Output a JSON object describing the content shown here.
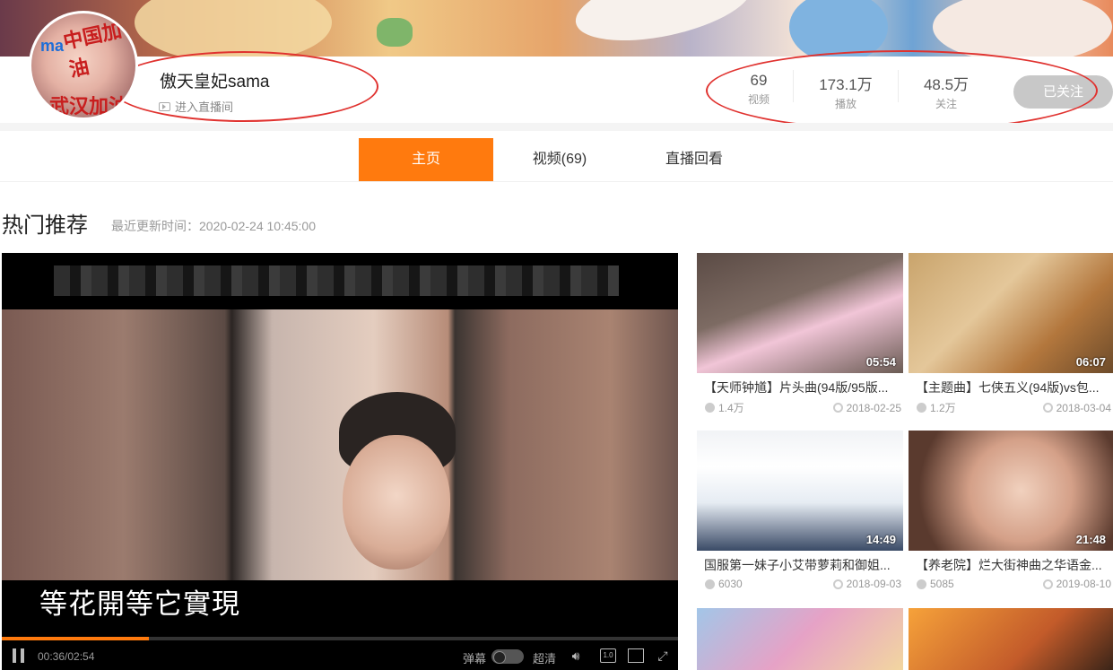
{
  "banner": {},
  "profile": {
    "avatar_text_1": "中国加油",
    "avatar_text_2": "武汉加油",
    "avatar_text_3": "ma",
    "username": "傲天皇妃sama",
    "live_link": "进入直播间"
  },
  "stats": [
    {
      "value": "69",
      "label": "视频"
    },
    {
      "value": "173.1万",
      "label": "播放"
    },
    {
      "value": "48.5万",
      "label": "关注"
    }
  ],
  "follow_button": "已关注",
  "tabs": [
    {
      "label": "主页",
      "active": true
    },
    {
      "label": "视频(69)",
      "active": false
    },
    {
      "label": "直播回看",
      "active": false
    }
  ],
  "section": {
    "title": "热门推荐",
    "update_time": "最近更新时间：2020-02-24 10:45:00"
  },
  "player": {
    "subtitle": "等花開等它實現",
    "time": "00:36/02:54",
    "progress": 0.218,
    "danmu_label": "弹幕",
    "quality": "超清",
    "speed_icon_text": "1.0"
  },
  "videos": [
    {
      "title": "【天师钟馗】片头曲(94版/95版...",
      "plays": "1.4万",
      "date": "2018-02-25",
      "duration": "05:54"
    },
    {
      "title": "【主题曲】七侠五义(94版)vs包...",
      "plays": "1.2万",
      "date": "2018-03-04",
      "duration": "06:07"
    },
    {
      "title": "国服第一妹子小艾带萝莉和御姐...",
      "plays": "6030",
      "date": "2018-09-03",
      "duration": "14:49"
    },
    {
      "title": "【养老院】烂大街神曲之华语金...",
      "plays": "5085",
      "date": "2019-08-10",
      "duration": "21:48"
    }
  ],
  "colors": {
    "accent": "#ff7a0e",
    "annotation": "#e0322f",
    "follow_bg": "#c8c8c8"
  }
}
